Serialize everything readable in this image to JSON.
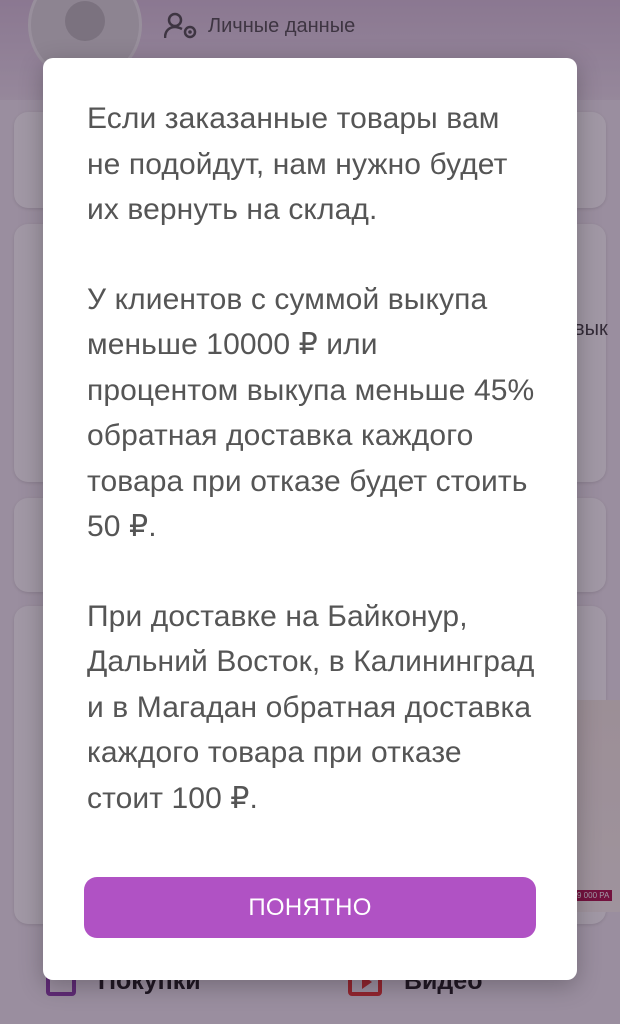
{
  "background": {
    "profile_link_label": "Личные данные",
    "side_fragment": "вык",
    "promo_tag": "9 000 РА",
    "bottom_nav": [
      {
        "label": "Покупки",
        "icon": "shopping-bag-icon",
        "color": "#8e44ad"
      },
      {
        "label": "Видео",
        "icon": "video-play-icon",
        "color": "#e53935"
      }
    ]
  },
  "dialog": {
    "paragraphs": [
      "Если заказанные товары вам не подойдут, нам нужно будет их вернуть на склад.",
      "У клиентов с суммой выкупа меньше 10000 ₽ или процентом выкупа меньше 45% обратная доставка каждого товара при отказе будет стоить 50 ₽.",
      "При доставке на Байконур, Дальний Восток, в Калининград и в Магадан обратная доставка каждого товара при отказе стоит 100 ₽."
    ],
    "confirm_label": "ПОНЯТНО"
  },
  "colors": {
    "accent": "#b052c4",
    "dialog_text": "#555555",
    "overlay": "rgba(30,10,40,0.42)"
  }
}
